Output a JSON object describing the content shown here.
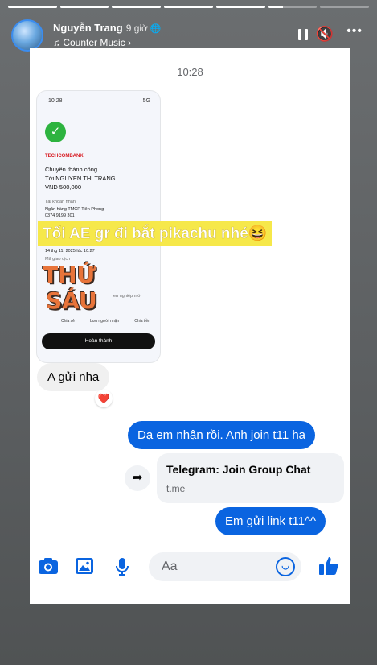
{
  "story": {
    "progress": [
      1,
      1,
      1,
      1,
      1,
      0.3,
      0
    ],
    "user_name": "Nguyễn Trang",
    "time_ago": "9 giờ",
    "music": "Counter Music",
    "colors": {
      "accent": "#0a64e0",
      "progress": "#ffffff"
    }
  },
  "chat": {
    "timestamp": "10:28",
    "screenshot": {
      "time": "10:28",
      "status": "5G",
      "bank": "TECHCOMBANK",
      "title": "Chuyển thành công",
      "to": "Tới NGUYEN THI TRANG",
      "amount": "VND 500,000",
      "acct_label": "Tài khoản nhận",
      "acct_bank": "Ngân hàng TMCP Tiên Phong",
      "acct_no": "0374 9199 301",
      "date": "14 thg 11, 2025 lúc 10:27",
      "txn_label": "Mã giao dịch",
      "extra": "en nghiệp mới",
      "actions": [
        "Chia sẻ",
        "Lưu người nhận",
        "Chia tiền"
      ],
      "done": "Hoàn thành"
    },
    "overlay_text": "Tối AE gr đi bắt pikachu nhé😆",
    "sticker": [
      "THỨ",
      "SÁU"
    ],
    "received": "A gửi nha",
    "reaction": "❤️",
    "sent_1": "Dạ em nhận rồi. Anh join t11 ha",
    "link": {
      "title": "Telegram: Join Group Chat",
      "domain": "t.me"
    },
    "sent_2": "Em gửi link t11^^",
    "composer_placeholder": "Aa"
  }
}
